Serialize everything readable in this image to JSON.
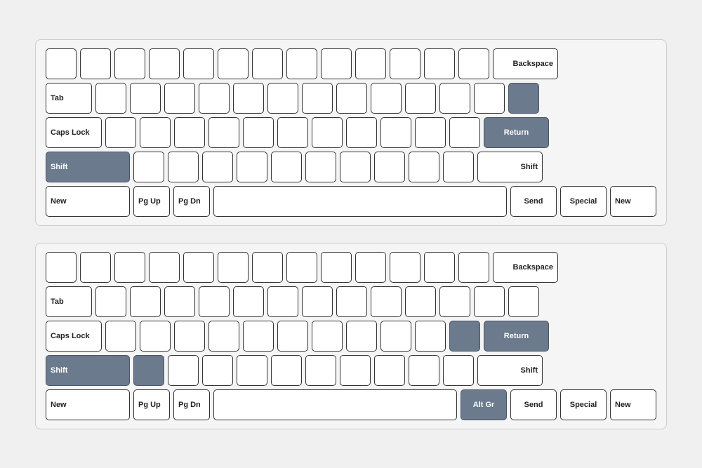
{
  "keyboards": [
    {
      "id": "keyboard-1",
      "rows": [
        {
          "id": "row-1-1",
          "keys": [
            {
              "id": "k1",
              "label": "",
              "size": "small",
              "highlight": false
            },
            {
              "id": "k2",
              "label": "",
              "size": "small",
              "highlight": false
            },
            {
              "id": "k3",
              "label": "",
              "size": "small",
              "highlight": false
            },
            {
              "id": "k4",
              "label": "",
              "size": "small",
              "highlight": false
            },
            {
              "id": "k5",
              "label": "",
              "size": "small",
              "highlight": false
            },
            {
              "id": "k6",
              "label": "",
              "size": "small",
              "highlight": false
            },
            {
              "id": "k7",
              "label": "",
              "size": "small",
              "highlight": false
            },
            {
              "id": "k8",
              "label": "",
              "size": "small",
              "highlight": false
            },
            {
              "id": "k9",
              "label": "",
              "size": "small",
              "highlight": false
            },
            {
              "id": "k10",
              "label": "",
              "size": "small",
              "highlight": false
            },
            {
              "id": "k11",
              "label": "",
              "size": "small",
              "highlight": false
            },
            {
              "id": "k12",
              "label": "",
              "size": "small",
              "highlight": false
            },
            {
              "id": "k13",
              "label": "",
              "size": "small",
              "highlight": false
            },
            {
              "id": "k14",
              "label": "Backspace",
              "size": "backspace",
              "highlight": false
            }
          ]
        },
        {
          "id": "row-1-2",
          "keys": [
            {
              "id": "k21",
              "label": "Tab",
              "size": "tab",
              "highlight": false
            },
            {
              "id": "k22",
              "label": "",
              "size": "small",
              "highlight": false
            },
            {
              "id": "k23",
              "label": "",
              "size": "small",
              "highlight": false
            },
            {
              "id": "k24",
              "label": "",
              "size": "small",
              "highlight": false
            },
            {
              "id": "k25",
              "label": "",
              "size": "small",
              "highlight": false
            },
            {
              "id": "k26",
              "label": "",
              "size": "small",
              "highlight": false
            },
            {
              "id": "k27",
              "label": "",
              "size": "small",
              "highlight": false
            },
            {
              "id": "k28",
              "label": "",
              "size": "small",
              "highlight": false
            },
            {
              "id": "k29",
              "label": "",
              "size": "small",
              "highlight": false
            },
            {
              "id": "k30",
              "label": "",
              "size": "small",
              "highlight": false
            },
            {
              "id": "k31",
              "label": "",
              "size": "small",
              "highlight": false
            },
            {
              "id": "k32",
              "label": "",
              "size": "small",
              "highlight": false
            },
            {
              "id": "k33",
              "label": "",
              "size": "small",
              "highlight": false
            },
            {
              "id": "k34",
              "label": "",
              "size": "small",
              "highlight": true
            }
          ]
        },
        {
          "id": "row-1-3",
          "keys": [
            {
              "id": "k41",
              "label": "Caps Lock",
              "size": "caps",
              "highlight": false
            },
            {
              "id": "k42",
              "label": "",
              "size": "small",
              "highlight": false
            },
            {
              "id": "k43",
              "label": "",
              "size": "small",
              "highlight": false
            },
            {
              "id": "k44",
              "label": "",
              "size": "small",
              "highlight": false
            },
            {
              "id": "k45",
              "label": "",
              "size": "small",
              "highlight": false
            },
            {
              "id": "k46",
              "label": "",
              "size": "small",
              "highlight": false
            },
            {
              "id": "k47",
              "label": "",
              "size": "small",
              "highlight": false
            },
            {
              "id": "k48",
              "label": "",
              "size": "small",
              "highlight": false
            },
            {
              "id": "k49",
              "label": "",
              "size": "small",
              "highlight": false
            },
            {
              "id": "k50",
              "label": "",
              "size": "small",
              "highlight": false
            },
            {
              "id": "k51",
              "label": "",
              "size": "small",
              "highlight": false
            },
            {
              "id": "k52",
              "label": "",
              "size": "small",
              "highlight": false
            },
            {
              "id": "k53",
              "label": "Return",
              "size": "return",
              "highlight": true
            }
          ]
        },
        {
          "id": "row-1-4",
          "keys": [
            {
              "id": "k61",
              "label": "Shift",
              "size": "shift-l",
              "highlight": true
            },
            {
              "id": "k62",
              "label": "",
              "size": "small",
              "highlight": false
            },
            {
              "id": "k63",
              "label": "",
              "size": "small",
              "highlight": false
            },
            {
              "id": "k64",
              "label": "",
              "size": "small",
              "highlight": false
            },
            {
              "id": "k65",
              "label": "",
              "size": "small",
              "highlight": false
            },
            {
              "id": "k66",
              "label": "",
              "size": "small",
              "highlight": false
            },
            {
              "id": "k67",
              "label": "",
              "size": "small",
              "highlight": false
            },
            {
              "id": "k68",
              "label": "",
              "size": "small",
              "highlight": false
            },
            {
              "id": "k69",
              "label": "",
              "size": "small",
              "highlight": false
            },
            {
              "id": "k70",
              "label": "",
              "size": "small",
              "highlight": false
            },
            {
              "id": "k71",
              "label": "",
              "size": "small",
              "highlight": false
            },
            {
              "id": "k72",
              "label": "Shift",
              "size": "shift-r",
              "highlight": false
            }
          ]
        },
        {
          "id": "row-1-5",
          "keys": [
            {
              "id": "k81",
              "label": "New",
              "size": "new-l",
              "highlight": false
            },
            {
              "id": "k82",
              "label": "Pg Up",
              "size": "pg",
              "highlight": false
            },
            {
              "id": "k83",
              "label": "Pg Dn",
              "size": "pg",
              "highlight": false
            },
            {
              "id": "k84",
              "label": "",
              "size": "space",
              "highlight": false
            },
            {
              "id": "k85",
              "label": "Send",
              "size": "send",
              "highlight": false
            },
            {
              "id": "k86",
              "label": "Special",
              "size": "special",
              "highlight": false
            },
            {
              "id": "k87",
              "label": "New",
              "size": "new-r",
              "highlight": false
            }
          ]
        }
      ]
    },
    {
      "id": "keyboard-2",
      "rows": [
        {
          "id": "row-2-1",
          "keys": [
            {
              "id": "m1",
              "label": "",
              "size": "small",
              "highlight": false
            },
            {
              "id": "m2",
              "label": "",
              "size": "small",
              "highlight": false
            },
            {
              "id": "m3",
              "label": "",
              "size": "small",
              "highlight": false
            },
            {
              "id": "m4",
              "label": "",
              "size": "small",
              "highlight": false
            },
            {
              "id": "m5",
              "label": "",
              "size": "small",
              "highlight": false
            },
            {
              "id": "m6",
              "label": "",
              "size": "small",
              "highlight": false
            },
            {
              "id": "m7",
              "label": "",
              "size": "small",
              "highlight": false
            },
            {
              "id": "m8",
              "label": "",
              "size": "small",
              "highlight": false
            },
            {
              "id": "m9",
              "label": "",
              "size": "small",
              "highlight": false
            },
            {
              "id": "m10",
              "label": "",
              "size": "small",
              "highlight": false
            },
            {
              "id": "m11",
              "label": "",
              "size": "small",
              "highlight": false
            },
            {
              "id": "m12",
              "label": "",
              "size": "small",
              "highlight": false
            },
            {
              "id": "m13",
              "label": "",
              "size": "small",
              "highlight": false
            },
            {
              "id": "m14",
              "label": "Backspace",
              "size": "backspace",
              "highlight": false
            }
          ]
        },
        {
          "id": "row-2-2",
          "keys": [
            {
              "id": "m21",
              "label": "Tab",
              "size": "tab",
              "highlight": false
            },
            {
              "id": "m22",
              "label": "",
              "size": "small",
              "highlight": false
            },
            {
              "id": "m23",
              "label": "",
              "size": "small",
              "highlight": false
            },
            {
              "id": "m24",
              "label": "",
              "size": "small",
              "highlight": false
            },
            {
              "id": "m25",
              "label": "",
              "size": "small",
              "highlight": false
            },
            {
              "id": "m26",
              "label": "",
              "size": "small",
              "highlight": false
            },
            {
              "id": "m27",
              "label": "",
              "size": "small",
              "highlight": false
            },
            {
              "id": "m28",
              "label": "",
              "size": "small",
              "highlight": false
            },
            {
              "id": "m29",
              "label": "",
              "size": "small",
              "highlight": false
            },
            {
              "id": "m30",
              "label": "",
              "size": "small",
              "highlight": false
            },
            {
              "id": "m31",
              "label": "",
              "size": "small",
              "highlight": false
            },
            {
              "id": "m32",
              "label": "",
              "size": "small",
              "highlight": false
            },
            {
              "id": "m33",
              "label": "",
              "size": "small",
              "highlight": false
            },
            {
              "id": "m34",
              "label": "",
              "size": "small",
              "highlight": false
            }
          ]
        },
        {
          "id": "row-2-3",
          "keys": [
            {
              "id": "m41",
              "label": "Caps Lock",
              "size": "caps",
              "highlight": false
            },
            {
              "id": "m42",
              "label": "",
              "size": "small",
              "highlight": false
            },
            {
              "id": "m43",
              "label": "",
              "size": "small",
              "highlight": false
            },
            {
              "id": "m44",
              "label": "",
              "size": "small",
              "highlight": false
            },
            {
              "id": "m45",
              "label": "",
              "size": "small",
              "highlight": false
            },
            {
              "id": "m46",
              "label": "",
              "size": "small",
              "highlight": false
            },
            {
              "id": "m47",
              "label": "",
              "size": "small",
              "highlight": false
            },
            {
              "id": "m48",
              "label": "",
              "size": "small",
              "highlight": false
            },
            {
              "id": "m49",
              "label": "",
              "size": "small",
              "highlight": false
            },
            {
              "id": "m50",
              "label": "",
              "size": "small",
              "highlight": false
            },
            {
              "id": "m51",
              "label": "",
              "size": "small",
              "highlight": false
            },
            {
              "id": "m52",
              "label": "",
              "size": "small",
              "highlight": true
            },
            {
              "id": "m53",
              "label": "Return",
              "size": "return",
              "highlight": true
            }
          ]
        },
        {
          "id": "row-2-4",
          "keys": [
            {
              "id": "m61",
              "label": "Shift",
              "size": "shift-l",
              "highlight": true
            },
            {
              "id": "m62",
              "label": "",
              "size": "small",
              "highlight": true
            },
            {
              "id": "m63",
              "label": "",
              "size": "small",
              "highlight": false
            },
            {
              "id": "m64",
              "label": "",
              "size": "small",
              "highlight": false
            },
            {
              "id": "m65",
              "label": "",
              "size": "small",
              "highlight": false
            },
            {
              "id": "m66",
              "label": "",
              "size": "small",
              "highlight": false
            },
            {
              "id": "m67",
              "label": "",
              "size": "small",
              "highlight": false
            },
            {
              "id": "m68",
              "label": "",
              "size": "small",
              "highlight": false
            },
            {
              "id": "m69",
              "label": "",
              "size": "small",
              "highlight": false
            },
            {
              "id": "m70",
              "label": "",
              "size": "small",
              "highlight": false
            },
            {
              "id": "m71",
              "label": "",
              "size": "small",
              "highlight": false
            },
            {
              "id": "m72",
              "label": "Shift",
              "size": "shift-r",
              "highlight": false
            }
          ]
        },
        {
          "id": "row-2-5",
          "keys": [
            {
              "id": "m81",
              "label": "New",
              "size": "new-l",
              "highlight": false
            },
            {
              "id": "m82",
              "label": "Pg Up",
              "size": "pg",
              "highlight": false
            },
            {
              "id": "m83",
              "label": "Pg Dn",
              "size": "pg",
              "highlight": false
            },
            {
              "id": "m84",
              "label": "",
              "size": "space",
              "highlight": false
            },
            {
              "id": "m85",
              "label": "Alt Gr",
              "size": "altgr",
              "highlight": true
            },
            {
              "id": "m86",
              "label": "Send",
              "size": "send",
              "highlight": false
            },
            {
              "id": "m87",
              "label": "Special",
              "size": "special",
              "highlight": false
            },
            {
              "id": "m88",
              "label": "New",
              "size": "new-r",
              "highlight": false
            }
          ]
        }
      ]
    }
  ]
}
